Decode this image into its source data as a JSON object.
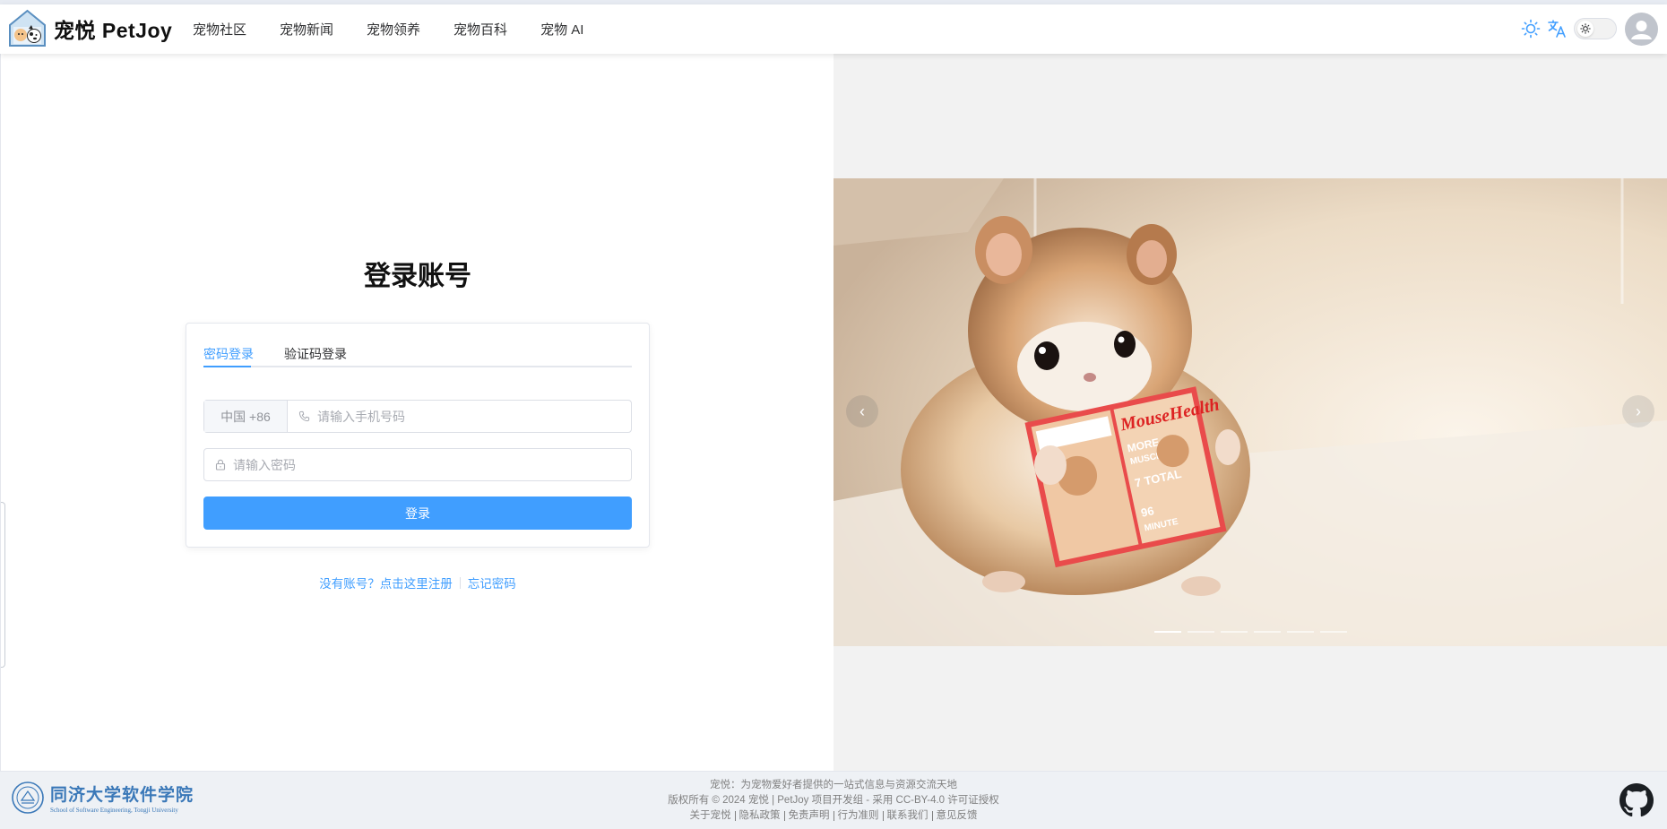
{
  "header": {
    "brand": "宠悦 PetJoy",
    "nav": [
      "宠物社区",
      "宠物新闻",
      "宠物领养",
      "宠物百科",
      "宠物 AI"
    ],
    "icons": {
      "theme": "sun-icon",
      "language": "translate-icon",
      "avatar": "user-avatar-icon"
    }
  },
  "login": {
    "title": "登录账号",
    "tabs": [
      "密码登录",
      "验证码登录"
    ],
    "active_tab": "密码登录",
    "phone_prefix": "中国 +86",
    "phone_placeholder": "请输入手机号码",
    "password_placeholder": "请输入密码",
    "submit_label": "登录",
    "register_link": "没有账号？点击这里注册",
    "forgot_link": "忘记密码",
    "accent_color": "#409eff"
  },
  "carousel": {
    "slide_count": 6,
    "active_index": 0,
    "prev_label": "‹",
    "next_label": "›"
  },
  "footer": {
    "school_cn": "同济大学软件学院",
    "school_en": "School of Software Engineering, Tongji University",
    "tagline": "宠悦：为宠物爱好者提供的一站式信息与资源交流天地",
    "copyright": "版权所有 © 2024 宠悦 | PetJoy 项目开发组 - 采用 CC-BY-4.0 许可证授权",
    "links": [
      "关于宠悦",
      "隐私政策",
      "免责声明",
      "行为准则",
      "联系我们",
      "意见反馈"
    ]
  }
}
